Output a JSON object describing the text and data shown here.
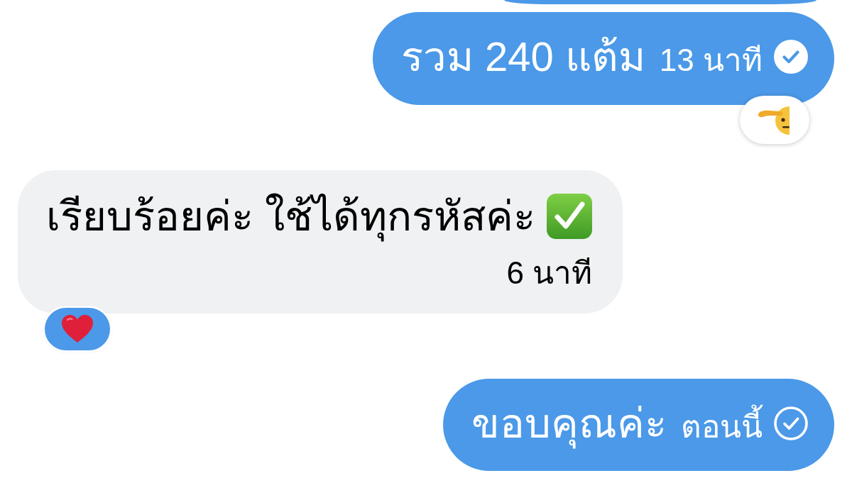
{
  "messages": [
    {
      "kind": "clipped",
      "mine": true
    },
    {
      "kind": "text",
      "mine": true,
      "text": "รวม 240 แต้ม",
      "time": "13 นาที",
      "read": true,
      "reaction": {
        "kind": "salute",
        "mine": false
      }
    },
    {
      "kind": "text",
      "mine": false,
      "text": "เรียบร้อยค่ะ ใช้ได้ทุกรหัสค่ะ",
      "emoji": {
        "kind": "check_box"
      },
      "time": "6 นาที",
      "reaction": {
        "kind": "heart",
        "mine": true
      }
    },
    {
      "kind": "text",
      "mine": true,
      "text": "ขอบคุณค่ะ",
      "time": "ตอนนี้",
      "read": false
    }
  ]
}
